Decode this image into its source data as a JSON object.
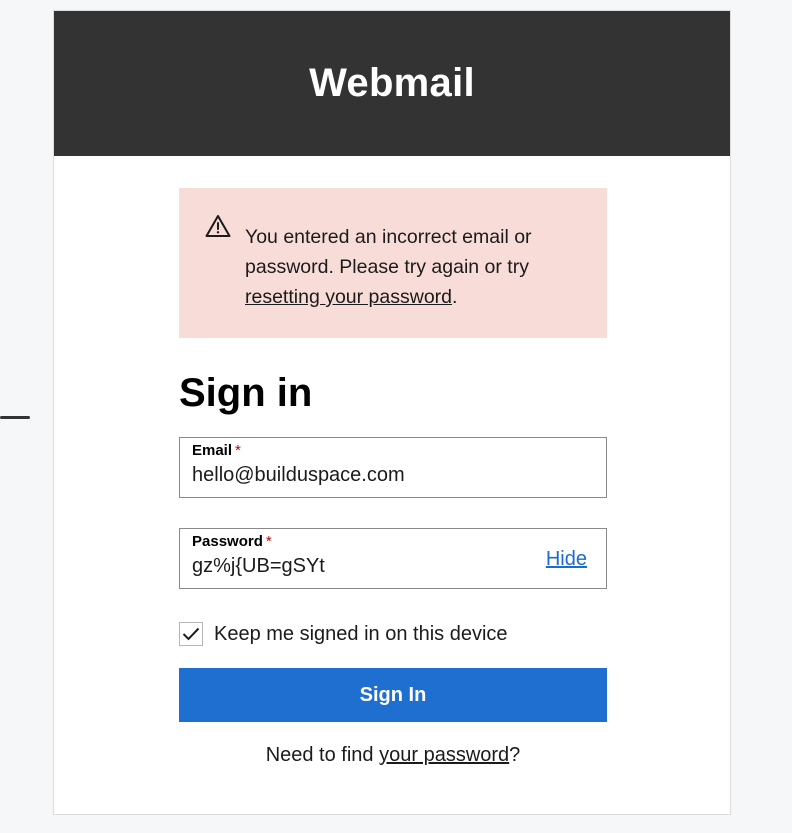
{
  "app": {
    "title": "Webmail"
  },
  "alert": {
    "icon": "warning-icon",
    "text_before": "You entered an incorrect email or password. Please try again or try ",
    "link_text": "resetting your password",
    "text_after": "."
  },
  "form": {
    "title": "Sign in",
    "email": {
      "label": "Email",
      "required_mark": "*",
      "value": "hello@builduspace.com"
    },
    "password": {
      "label": "Password",
      "required_mark": "*",
      "value": "gz%j{UB=gSYt",
      "toggle_label": "Hide"
    },
    "keep_signed_in": {
      "label": "Keep me signed in on this device",
      "checked": true
    },
    "submit_label": "Sign In",
    "footer": {
      "text_before": "Need to find ",
      "link_text": "your password",
      "text_after": "?"
    }
  },
  "colors": {
    "header_bg": "#333333",
    "alert_bg": "#f8dcd8",
    "primary": "#1f6fd1",
    "link": "#1c6bd2",
    "required": "#b50909"
  }
}
